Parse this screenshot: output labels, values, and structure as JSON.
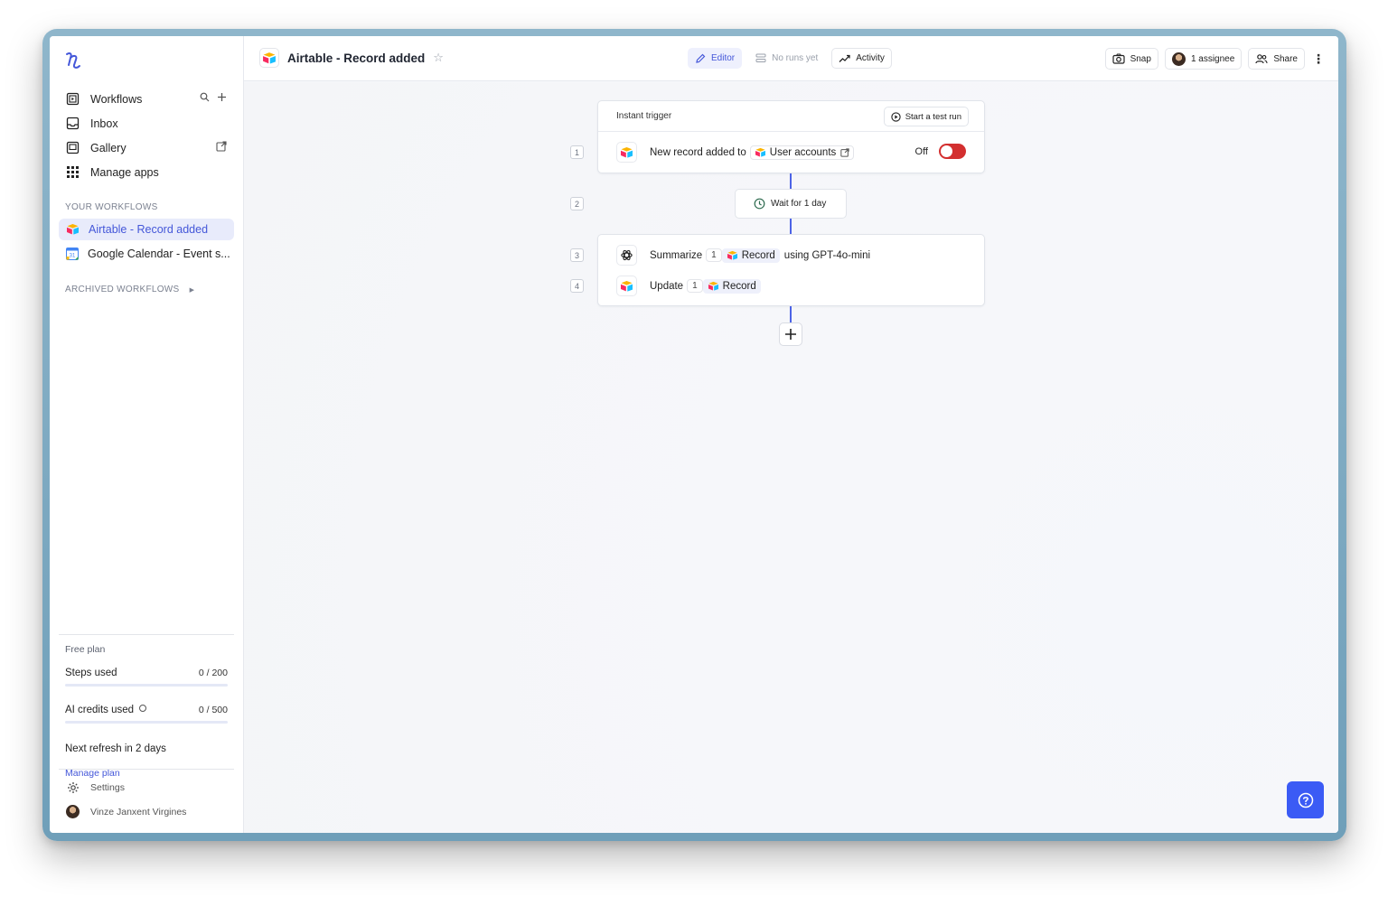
{
  "sidebar": {
    "nav": [
      {
        "label": "Workflows",
        "icon": "workflows-icon"
      },
      {
        "label": "Inbox",
        "icon": "inbox-icon"
      },
      {
        "label": "Gallery",
        "icon": "gallery-icon"
      },
      {
        "label": "Manage apps",
        "icon": "grid-icon"
      }
    ],
    "your_workflows_label": "YOUR WORKFLOWS",
    "workflows": [
      {
        "label": "Airtable - Record added",
        "icon": "airtable-icon",
        "active": true
      },
      {
        "label": "Google Calendar - Event s...",
        "icon": "google-calendar-icon",
        "active": false
      }
    ],
    "archived_label": "ARCHIVED WORKFLOWS",
    "plan": {
      "title": "Free plan",
      "steps_label": "Steps used",
      "steps_value": "0 / 200",
      "steps_fraction": 0,
      "ai_label": "AI credits used",
      "ai_value": "0 / 500",
      "ai_fraction": 0,
      "refresh": "Next refresh in 2 days",
      "manage": "Manage plan"
    },
    "settings": "Settings",
    "user": "Vinze Janxent Virgines"
  },
  "topbar": {
    "title": "Airtable - Record added",
    "tabs": {
      "editor": "Editor",
      "runs": "No runs yet",
      "activity": "Activity"
    },
    "snap": "Snap",
    "assignee": "1 assignee",
    "share": "Share"
  },
  "canvas": {
    "trigger_label": "Instant trigger",
    "test_run": "Start a test run",
    "steps": [
      {
        "num": "1",
        "text": "New record added to",
        "chip": "User accounts",
        "toggle_label": "Off",
        "enabled": false
      },
      {
        "num": "2",
        "text": "Wait for 1 day"
      },
      {
        "num": "3",
        "text": "Summarize",
        "ref_num": "1",
        "chip": "Record",
        "suffix": "using GPT-4o-mini"
      },
      {
        "num": "4",
        "text": "Update",
        "ref_num": "1",
        "chip": "Record"
      }
    ]
  },
  "colors": {
    "accent": "#4457d9",
    "toggle_off": "#d32f2f",
    "help": "#3b5bf5"
  }
}
